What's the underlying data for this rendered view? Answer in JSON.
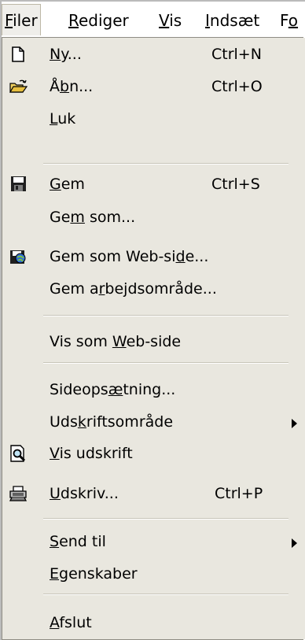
{
  "menubar": {
    "items": [
      {
        "pre": "",
        "ul": "F",
        "post": "iler"
      },
      {
        "pre": "",
        "ul": "R",
        "post": "ediger"
      },
      {
        "pre": "",
        "ul": "V",
        "post": "is"
      },
      {
        "pre": "",
        "ul": "I",
        "post": "ndsæt"
      },
      {
        "pre": "F",
        "ul": "o",
        "post": ""
      }
    ]
  },
  "menu": {
    "ny": {
      "pre": "",
      "ul": "N",
      "post": "y...",
      "shortcut": "Ctrl+N",
      "icon": "new-document-icon"
    },
    "aabn": {
      "pre": "Å",
      "ul": "b",
      "post": "n...",
      "shortcut": "Ctrl+O",
      "icon": "open-folder-icon"
    },
    "luk": {
      "pre": "",
      "ul": "L",
      "post": "uk"
    },
    "gem": {
      "pre": "",
      "ul": "G",
      "post": "em",
      "shortcut": "Ctrl+S",
      "icon": "save-disk-icon"
    },
    "gem_som": {
      "pre": "Ge",
      "ul": "m",
      "post": " som..."
    },
    "gem_web": {
      "pre": "Gem som Web-si",
      "ul": "d",
      "post": "e...",
      "icon": "save-web-icon"
    },
    "gem_arb": {
      "pre": "Gem a",
      "ul": "r",
      "post": "bejdsområde..."
    },
    "vis_web": {
      "pre": "Vis som ",
      "ul": "W",
      "post": "eb-side"
    },
    "sideops": {
      "pre": "Sideops",
      "ul": "æ",
      "post": "tning..."
    },
    "udskriftsomr": {
      "pre": "Uds",
      "ul": "k",
      "post": "riftsområde"
    },
    "vis_udskrift": {
      "pre": "",
      "ul": "V",
      "post": "is udskrift",
      "icon": "print-preview-icon"
    },
    "udskriv": {
      "pre": "",
      "ul": "U",
      "post": "dskriv...",
      "shortcut": "Ctrl+P",
      "icon": "printer-icon"
    },
    "send_til": {
      "pre": "",
      "ul": "S",
      "post": "end til"
    },
    "egenskaber": {
      "pre": "",
      "ul": "E",
      "post": "genskaber"
    },
    "afslut": {
      "pre": "",
      "ul": "A",
      "post": "fslut"
    }
  }
}
